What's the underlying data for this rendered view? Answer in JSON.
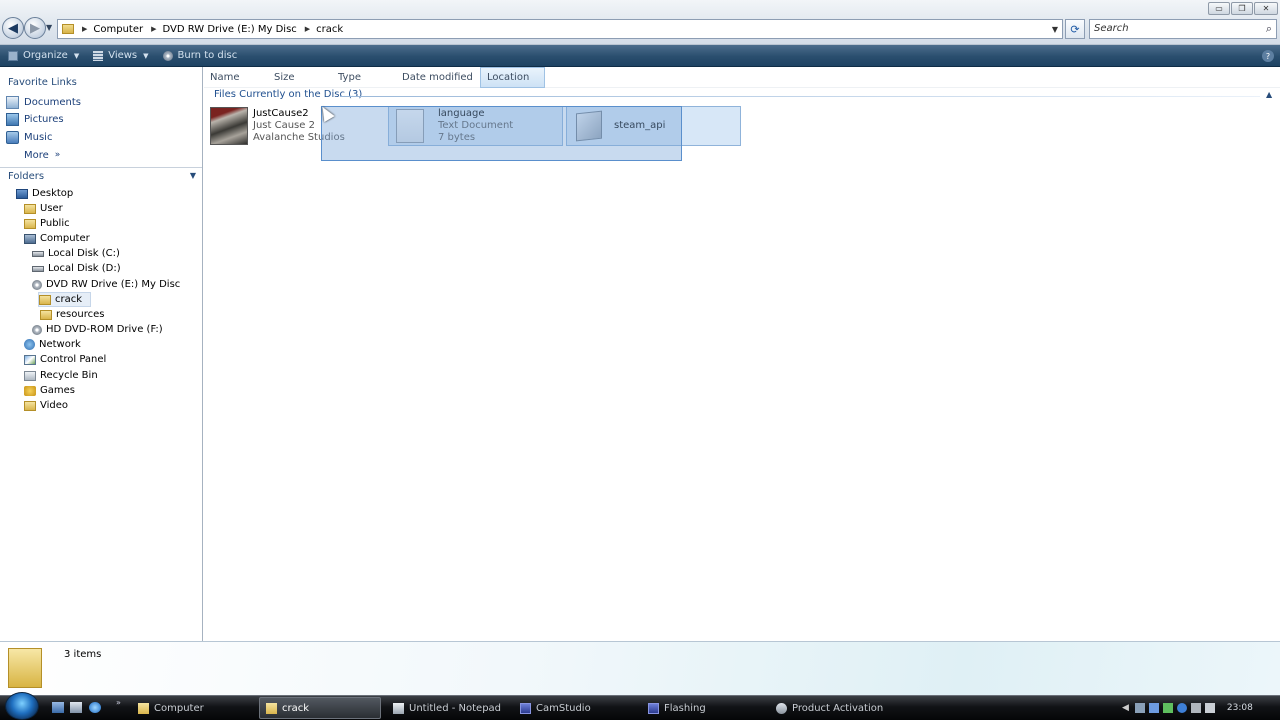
{
  "window": {
    "controls": {
      "minimize": "▭",
      "maximize": "❐",
      "close": "✕"
    }
  },
  "address": {
    "breadcrumbs": [
      "Computer",
      "DVD RW Drive (E:) My Disc",
      "crack"
    ],
    "search_placeholder": "Search"
  },
  "toolbar": {
    "organize": "Organize",
    "views": "Views",
    "burn": "Burn to disc",
    "help": "?"
  },
  "sidebar": {
    "favorites_title": "Favorite Links",
    "favorites": [
      {
        "label": "Documents",
        "icon": "documents-icon"
      },
      {
        "label": "Pictures",
        "icon": "pictures-icon"
      },
      {
        "label": "Music",
        "icon": "music-icon"
      },
      {
        "label": "More",
        "icon": "double-chevron-icon"
      }
    ],
    "folders_title": "Folders",
    "tree": [
      {
        "label": "Desktop",
        "icon": "desktop-icon"
      },
      {
        "label": "User",
        "icon": "folder-icon"
      },
      {
        "label": "Public",
        "icon": "folder-icon"
      },
      {
        "label": "Computer",
        "icon": "computer-icon"
      },
      {
        "label": "Local Disk (C:)",
        "icon": "disk-icon"
      },
      {
        "label": "Local Disk (D:)",
        "icon": "disk-icon"
      },
      {
        "label": "DVD RW Drive (E:) My Disc",
        "icon": "dvd-icon"
      },
      {
        "label": "crack",
        "icon": "folder-icon",
        "selected": true
      },
      {
        "label": "resources",
        "icon": "folder-icon"
      },
      {
        "label": "HD DVD-ROM Drive (F:)",
        "icon": "dvd-icon"
      },
      {
        "label": "Network",
        "icon": "network-icon"
      },
      {
        "label": "Control Panel",
        "icon": "control-panel-icon"
      },
      {
        "label": "Recycle Bin",
        "icon": "recycle-bin-icon"
      },
      {
        "label": "Games",
        "icon": "games-icon"
      },
      {
        "label": "Video",
        "icon": "folder-icon"
      }
    ]
  },
  "columns": [
    "Name",
    "Size",
    "Type",
    "Date modified",
    "Location"
  ],
  "group": {
    "title": "Files Currently on the Disc (3)"
  },
  "files": [
    {
      "name": "JustCause2",
      "line2": "Just Cause 2",
      "line3": "Avalanche Studios",
      "icon": "game-thumbnail"
    },
    {
      "name": "language",
      "line2": "Text Document",
      "line3": "7 bytes",
      "icon": "text-document-icon"
    },
    {
      "name": "steam_api",
      "line2": "",
      "line3": "",
      "icon": "dll-file-icon"
    }
  ],
  "details": {
    "count_text": "3 items"
  },
  "taskbar": {
    "tasks": [
      {
        "label": "Computer",
        "icon": "folder-icon",
        "active": false
      },
      {
        "label": "crack",
        "icon": "folder-icon",
        "active": true
      },
      {
        "label": "Untitled - Notepad",
        "icon": "notepad-icon",
        "active": false
      },
      {
        "label": "CamStudio",
        "icon": "camstudio-icon",
        "active": false
      },
      {
        "label": "Flashing",
        "icon": "camstudio-icon",
        "active": false
      },
      {
        "label": "Product Activation",
        "icon": "key-icon",
        "active": false
      }
    ],
    "clock": "23:08"
  },
  "colors": {
    "accent": "#1f4f8f",
    "selection": "#7ba8d8",
    "cmdbar": "#2a4e6e"
  }
}
